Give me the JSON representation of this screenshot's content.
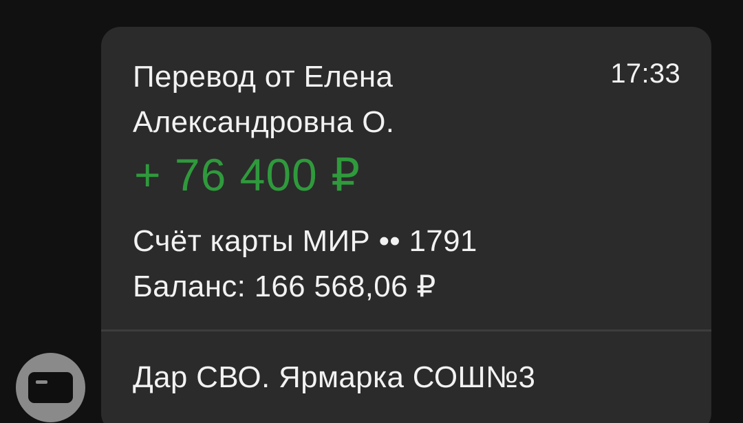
{
  "message": {
    "sender_line": "Перевод от Елена Александровна О.",
    "time": "17:33",
    "amount": "+ 76 400 ₽",
    "account": "Счёт карты МИР •• 1791",
    "balance": "Баланс: 166 568,06 ₽",
    "comment": "Дар СВО. Ярмарка СОШ№3"
  },
  "avatar": {
    "icon": "bank-card-icon"
  },
  "colors": {
    "background": "#111111",
    "bubble": "#2b2b2b",
    "text": "#f2f2f2",
    "amount_green": "#2f9a3c",
    "avatar_circle": "#8a8a8a"
  }
}
